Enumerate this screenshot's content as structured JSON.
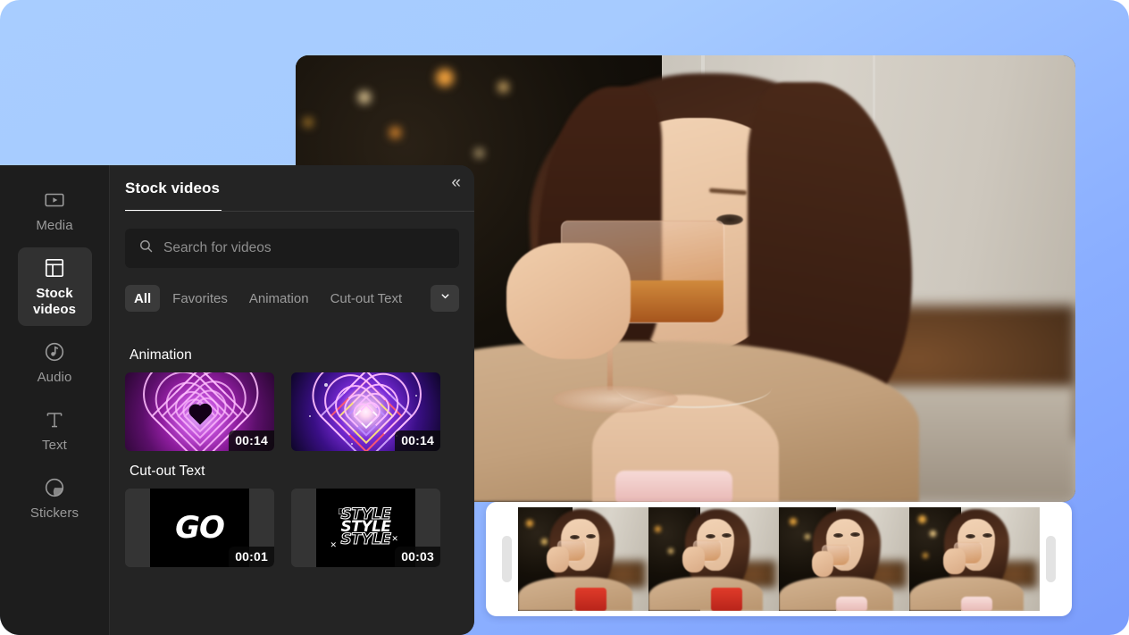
{
  "app": {
    "background_gradient_start": "#a8cdff",
    "background_gradient_end": "#7b9dfc"
  },
  "sidebar": {
    "items": [
      {
        "label": "Media",
        "icon": "media-play-rect-icon",
        "active": false
      },
      {
        "label": "Stock videos",
        "icon": "layout-grid-icon",
        "active": true
      },
      {
        "label": "Audio",
        "icon": "music-note-circle-icon",
        "active": false
      },
      {
        "label": "Text",
        "icon": "text-t-icon",
        "active": false
      },
      {
        "label": "Stickers",
        "icon": "sticker-peel-circle-icon",
        "active": false
      }
    ]
  },
  "panel": {
    "title": "Stock videos",
    "collapse_icon": "«",
    "search": {
      "placeholder": "Search for videos",
      "value": "",
      "icon": "search-icon"
    },
    "filters": {
      "chips": [
        {
          "label": "All",
          "active": true
        },
        {
          "label": "Favorites",
          "active": false
        },
        {
          "label": "Animation",
          "active": false
        },
        {
          "label": "Cut-out Text",
          "active": false
        }
      ],
      "more_icon": "chevron-down-icon"
    },
    "sections": [
      {
        "title": "Animation",
        "items": [
          {
            "name": "pink-neon-heart-tunnel",
            "duration": "00:14"
          },
          {
            "name": "rainbow-neon-heart",
            "duration": "00:14"
          }
        ]
      },
      {
        "title": "Cut-out Text",
        "items": [
          {
            "name": "go-cutout-text",
            "duration": "00:01",
            "text": "GO"
          },
          {
            "name": "style-cutout-text",
            "duration": "00:03",
            "text": "STYLE"
          }
        ]
      }
    ]
  },
  "preview": {
    "name": "woman-drinking-from-glass-near-christmas-tree"
  },
  "timeline": {
    "clip_name": "selected-video-clip",
    "frame_count": 4,
    "left_handle": "trim-left-handle",
    "right_handle": "trim-right-handle"
  }
}
